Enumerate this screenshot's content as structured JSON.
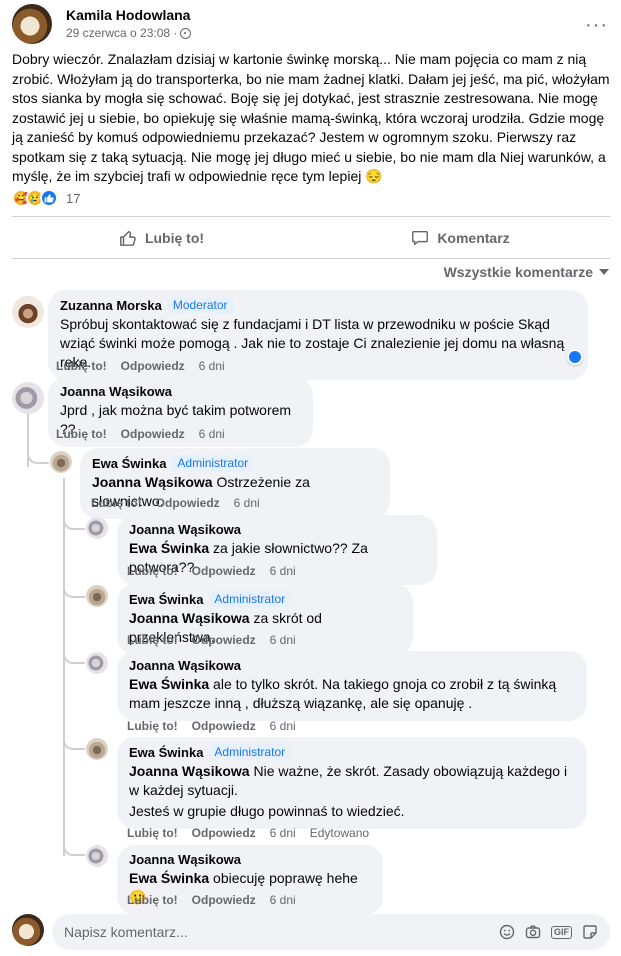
{
  "post": {
    "author": "Kamila Hodowlana",
    "date": "29 czerwca o 23:08 ·",
    "menu": "···",
    "text": "Dobry wieczór. Znalazłam dzisiaj w kartonie świnkę morską... Nie mam pojęcia co mam z nią zrobić. Włożyłam ją do transporterka, bo nie mam żadnej klatki. Dałam jej jeść, ma pić, włożyłam stos sianka by mogła się schować. Boję się jej dotykać, jest strasznie zestresowana. Nie mogę zostawić jej u siebie, bo opiekuję się właśnie mamą-świnką, która wczoraj urodziła. Gdzie mogę ją zanieść by komuś odpowiedniemu przekazać? Jestem w ogromnym szoku. Pierwszy raz spotkam się z taką sytuacją. Nie mogę jej długo mieć u siebie, bo nie mam dla Niej warunków, a myślę, że im szybciej trafi w odpowiednie ręce tym lepiej 😔",
    "reaction_count": "17"
  },
  "actions": {
    "like": "Lubię to!",
    "comment": "Komentarz"
  },
  "sort_label": "Wszystkie komentarze",
  "labels": {
    "like": "Lubię to!",
    "reply": "Odpowiedz",
    "edited": "Edytowano"
  },
  "comments": [
    {
      "name": "Zuzanna Morska",
      "badge": "Moderator",
      "mention": "",
      "text": "Spróbuj skontaktować się z fundacjami i DT lista w przewodniku w poście Skąd wziąć świnki może pomogą . Jak nie to zostaje Ci znalezienie jej domu na własną rękę.",
      "time": "6 dni"
    },
    {
      "name": "Joanna Wąsikowa",
      "badge": "",
      "mention": "",
      "text": "Jprd , jak można być takim potworem ??",
      "time": "6 dni"
    },
    {
      "name": "Ewa Świnka",
      "badge": "Administrator",
      "mention": "Joanna Wąsikowa",
      "text": " Ostrzeżenie za słownictwo.",
      "time": "6 dni"
    },
    {
      "name": "Joanna Wąsikowa",
      "badge": "",
      "mention": "Ewa Świnka",
      "text": " za jakie słownictwo?? Za potwora??",
      "time": "6 dni"
    },
    {
      "name": "Ewa Świnka",
      "badge": "Administrator",
      "mention": "Joanna Wąsikowa",
      "text": " za skrót od przekleństwa.",
      "time": "6 dni"
    },
    {
      "name": "Joanna Wąsikowa",
      "badge": "",
      "mention": "Ewa Świnka",
      "text": " ale to tylko skrót. Na takiego gnoja co zrobił z tą świnką mam jeszcze inną , dłuższą wiązankę, ale się opanuję .",
      "time": "6 dni"
    },
    {
      "name": "Ewa Świnka",
      "badge": "Administrator",
      "mention": "Joanna Wąsikowa",
      "text": " Nie ważne, że skrót. Zasady obowiązują każdego i w każdej sytuacji.",
      "text2": "Jesteś w grupie długo powinnaś to wiedzieć.",
      "time": "6 dni"
    },
    {
      "name": "Joanna Wąsikowa",
      "badge": "",
      "mention": "Ewa Świnka",
      "text": " obiecuję poprawę hehe 🙂",
      "time": "6 dni"
    }
  ],
  "composer": {
    "placeholder": "Napisz komentarz..."
  },
  "colors": {
    "accent": "#1877f2",
    "bubble": "#f0f2f5",
    "secondary_text": "#65676b"
  },
  "icons": [
    "globe-icon",
    "more-icon",
    "care-reaction-icon",
    "sad-reaction-icon",
    "like-reaction-icon",
    "thumbs-up-icon",
    "comment-icon",
    "chevron-down-icon",
    "emoji-icon",
    "camera-icon",
    "gif-icon",
    "sticker-icon"
  ]
}
